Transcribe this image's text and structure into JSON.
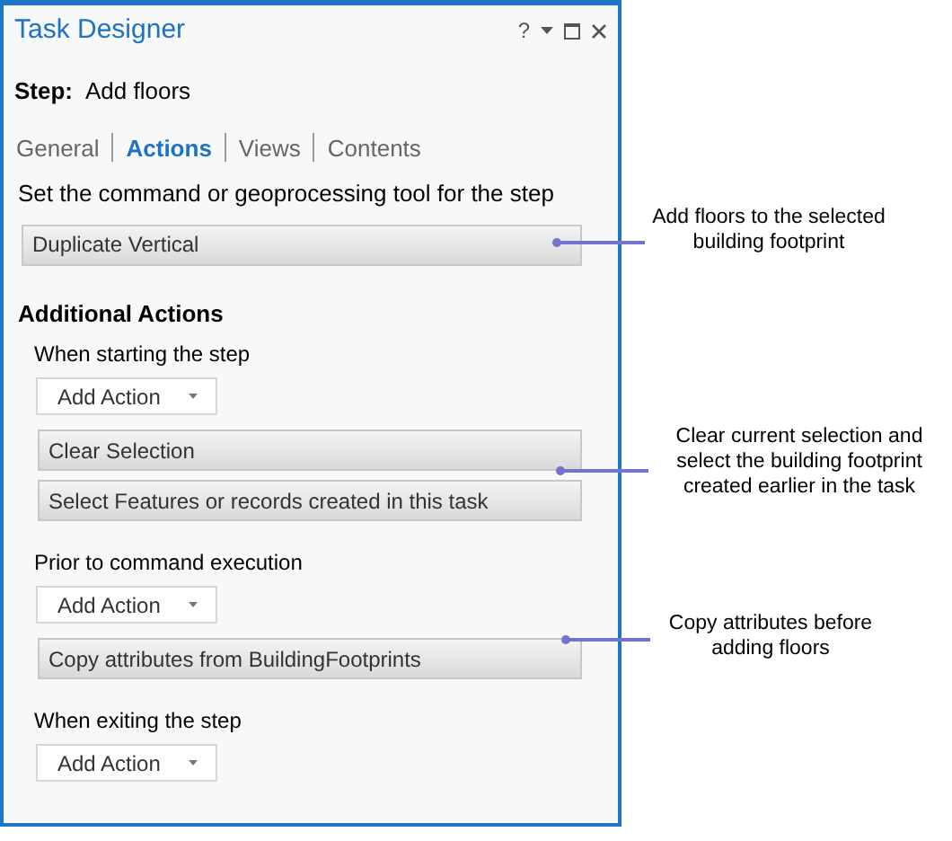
{
  "panel": {
    "title": "Task Designer",
    "help": "?"
  },
  "step": {
    "label": "Step:",
    "value": "Add floors"
  },
  "tabs": [
    {
      "label": "General",
      "selected": false
    },
    {
      "label": "Actions",
      "selected": true
    },
    {
      "label": "Views",
      "selected": false
    },
    {
      "label": "Contents",
      "selected": false
    }
  ],
  "command": {
    "heading": "Set the command or geoprocessing tool for the step",
    "value": "Duplicate Vertical"
  },
  "additional_actions": {
    "heading": "Additional Actions",
    "groups": [
      {
        "label": "When starting the step",
        "add_action": "Add Action",
        "actions": [
          "Clear Selection",
          "Select Features or records created in this task"
        ]
      },
      {
        "label": "Prior to command execution",
        "add_action": "Add Action",
        "actions": [
          "Copy attributes from BuildingFootprints"
        ]
      },
      {
        "label": "When exiting the step",
        "add_action": "Add Action"
      }
    ]
  },
  "callouts": [
    {
      "text": "Add floors to the selected building footprint"
    },
    {
      "text": "Clear current selection and select the building footprint created earlier in the task"
    },
    {
      "text": "Copy attributes before adding floors"
    }
  ]
}
